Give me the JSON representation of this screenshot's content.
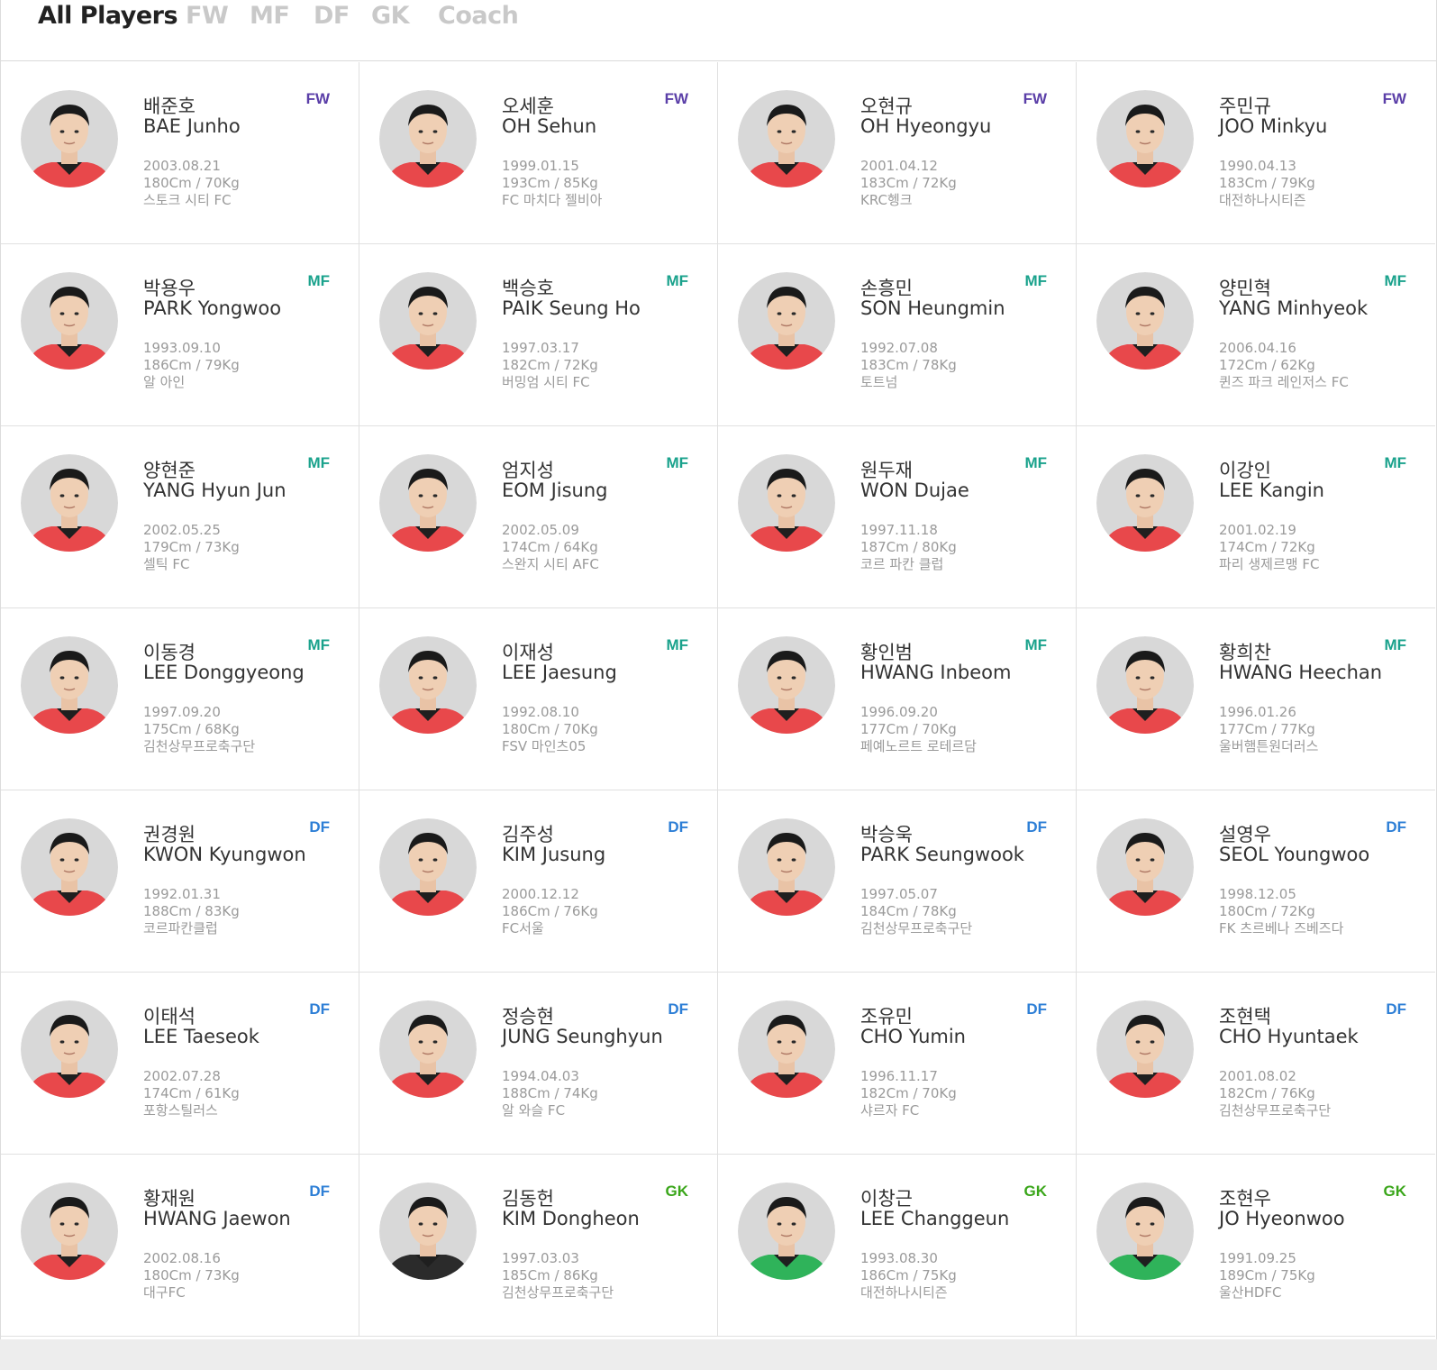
{
  "tabs": [
    {
      "label": "All Players",
      "active": true
    },
    {
      "label": "FW",
      "active": false
    },
    {
      "label": "MF",
      "active": false
    },
    {
      "label": "DF",
      "active": false
    },
    {
      "label": "GK",
      "active": false
    },
    {
      "label": "Coach",
      "active": false
    }
  ],
  "colors": {
    "FW": "#5b3fa8",
    "MF": "#1aa28c",
    "DF": "#2e7fd6",
    "GK": "#3aa61a",
    "kit_red": "#e8484b",
    "kit_green": "#2fb35a",
    "kit_black": "#2b2b2b"
  },
  "players": [
    {
      "name_ko": "배준호",
      "name_en": "BAE Junho",
      "position": "FW",
      "dob": "2003.08.21",
      "height_weight": "180Cm / 70Kg",
      "club": "스토크 시티 FC",
      "kit": "red"
    },
    {
      "name_ko": "오세훈",
      "name_en": "OH Sehun",
      "position": "FW",
      "dob": "1999.01.15",
      "height_weight": "193Cm / 85Kg",
      "club": "FC 마치다 젤비아",
      "kit": "red"
    },
    {
      "name_ko": "오현규",
      "name_en": "OH Hyeongyu",
      "position": "FW",
      "dob": "2001.04.12",
      "height_weight": "183Cm / 72Kg",
      "club": "KRC헹크",
      "kit": "red"
    },
    {
      "name_ko": "주민규",
      "name_en": "JOO Minkyu",
      "position": "FW",
      "dob": "1990.04.13",
      "height_weight": "183Cm / 79Kg",
      "club": "대전하나시티즌",
      "kit": "red"
    },
    {
      "name_ko": "박용우",
      "name_en": "PARK Yongwoo",
      "position": "MF",
      "dob": "1993.09.10",
      "height_weight": "186Cm / 79Kg",
      "club": "알 아인",
      "kit": "red"
    },
    {
      "name_ko": "백승호",
      "name_en": "PAIK Seung Ho",
      "position": "MF",
      "dob": "1997.03.17",
      "height_weight": "182Cm / 72Kg",
      "club": "버밍엄 시티 FC",
      "kit": "red"
    },
    {
      "name_ko": "손흥민",
      "name_en": "SON Heungmin",
      "position": "MF",
      "dob": "1992.07.08",
      "height_weight": "183Cm / 78Kg",
      "club": "토트넘",
      "kit": "red"
    },
    {
      "name_ko": "양민혁",
      "name_en": "YANG Minhyeok",
      "position": "MF",
      "dob": "2006.04.16",
      "height_weight": "172Cm / 62Kg",
      "club": "퀸즈 파크 레인저스 FC",
      "kit": "red"
    },
    {
      "name_ko": "양현준",
      "name_en": "YANG Hyun Jun",
      "position": "MF",
      "dob": "2002.05.25",
      "height_weight": "179Cm / 73Kg",
      "club": "셀틱 FC",
      "kit": "red"
    },
    {
      "name_ko": "엄지성",
      "name_en": "EOM Jisung",
      "position": "MF",
      "dob": "2002.05.09",
      "height_weight": "174Cm / 64Kg",
      "club": "스완지 시티 AFC",
      "kit": "red"
    },
    {
      "name_ko": "원두재",
      "name_en": "WON Dujae",
      "position": "MF",
      "dob": "1997.11.18",
      "height_weight": "187Cm / 80Kg",
      "club": "코르 파칸 클럽",
      "kit": "red"
    },
    {
      "name_ko": "이강인",
      "name_en": "LEE Kangin",
      "position": "MF",
      "dob": "2001.02.19",
      "height_weight": "174Cm / 72Kg",
      "club": "파리 생제르맹 FC",
      "kit": "red"
    },
    {
      "name_ko": "이동경",
      "name_en": "LEE Donggyeong",
      "position": "MF",
      "dob": "1997.09.20",
      "height_weight": "175Cm / 68Kg",
      "club": "김천상무프로축구단",
      "kit": "red"
    },
    {
      "name_ko": "이재성",
      "name_en": "LEE Jaesung",
      "position": "MF",
      "dob": "1992.08.10",
      "height_weight": "180Cm / 70Kg",
      "club": "FSV 마인츠05",
      "kit": "red"
    },
    {
      "name_ko": "황인범",
      "name_en": "HWANG Inbeom",
      "position": "MF",
      "dob": "1996.09.20",
      "height_weight": "177Cm / 70Kg",
      "club": "페예노르트 로테르담",
      "kit": "red"
    },
    {
      "name_ko": "황희찬",
      "name_en": "HWANG Heechan",
      "position": "MF",
      "dob": "1996.01.26",
      "height_weight": "177Cm / 77Kg",
      "club": "울버햄튼원더러스",
      "kit": "red"
    },
    {
      "name_ko": "권경원",
      "name_en": "KWON Kyungwon",
      "position": "DF",
      "dob": "1992.01.31",
      "height_weight": "188Cm / 83Kg",
      "club": "코르파칸클럽",
      "kit": "red"
    },
    {
      "name_ko": "김주성",
      "name_en": "KIM Jusung",
      "position": "DF",
      "dob": "2000.12.12",
      "height_weight": "186Cm / 76Kg",
      "club": "FC서울",
      "kit": "red"
    },
    {
      "name_ko": "박승욱",
      "name_en": "PARK Seungwook",
      "position": "DF",
      "dob": "1997.05.07",
      "height_weight": "184Cm / 78Kg",
      "club": "김천상무프로축구단",
      "kit": "red"
    },
    {
      "name_ko": "설영우",
      "name_en": "SEOL Youngwoo",
      "position": "DF",
      "dob": "1998.12.05",
      "height_weight": "180Cm / 72Kg",
      "club": "FK 츠르베나 즈베즈다",
      "kit": "red"
    },
    {
      "name_ko": "이태석",
      "name_en": "LEE Taeseok",
      "position": "DF",
      "dob": "2002.07.28",
      "height_weight": "174Cm / 61Kg",
      "club": "포항스틸러스",
      "kit": "red"
    },
    {
      "name_ko": "정승현",
      "name_en": "JUNG Seunghyun",
      "position": "DF",
      "dob": "1994.04.03",
      "height_weight": "188Cm / 74Kg",
      "club": "알 와슬 FC",
      "kit": "red"
    },
    {
      "name_ko": "조유민",
      "name_en": "CHO Yumin",
      "position": "DF",
      "dob": "1996.11.17",
      "height_weight": "182Cm / 70Kg",
      "club": "샤르자 FC",
      "kit": "red"
    },
    {
      "name_ko": "조현택",
      "name_en": "CHO Hyuntaek",
      "position": "DF",
      "dob": "2001.08.02",
      "height_weight": "182Cm / 76Kg",
      "club": "김천상무프로축구단",
      "kit": "red"
    },
    {
      "name_ko": "황재원",
      "name_en": "HWANG Jaewon",
      "position": "DF",
      "dob": "2002.08.16",
      "height_weight": "180Cm / 73Kg",
      "club": "대구FC",
      "kit": "red"
    },
    {
      "name_ko": "김동헌",
      "name_en": "KIM Dongheon",
      "position": "GK",
      "dob": "1997.03.03",
      "height_weight": "185Cm / 86Kg",
      "club": "김천상무프로축구단",
      "kit": "black"
    },
    {
      "name_ko": "이창근",
      "name_en": "LEE Changgeun",
      "position": "GK",
      "dob": "1993.08.30",
      "height_weight": "186Cm / 75Kg",
      "club": "대전하나시티즌",
      "kit": "green"
    },
    {
      "name_ko": "조현우",
      "name_en": "JO Hyeonwoo",
      "position": "GK",
      "dob": "1991.09.25",
      "height_weight": "189Cm / 75Kg",
      "club": "울산HDFC",
      "kit": "green"
    }
  ]
}
